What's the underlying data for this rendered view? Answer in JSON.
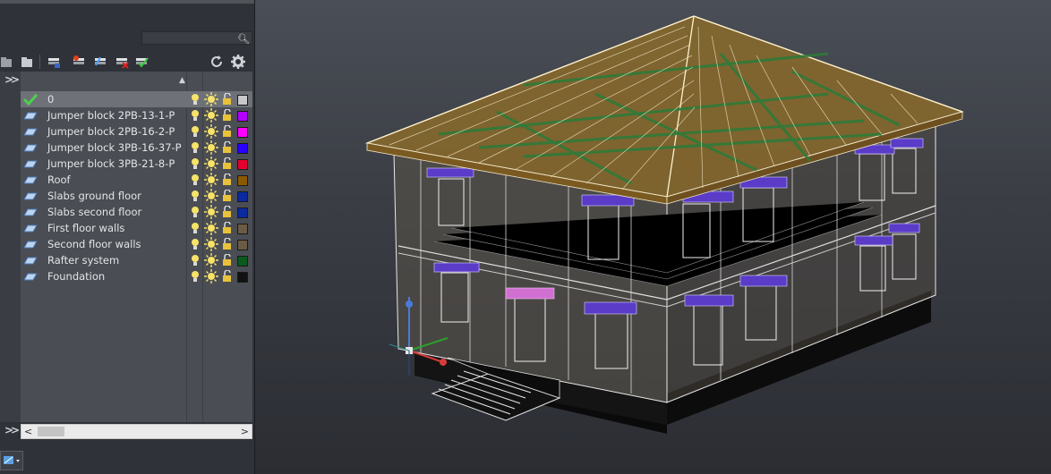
{
  "layer_panel": {
    "search_placeholder": "",
    "layers": [
      {
        "name": "0",
        "color": "#c8c8c8",
        "current": true
      },
      {
        "name": "Jumper block 2PB-13-1-P",
        "color": "#b400ff"
      },
      {
        "name": "Jumper block 2PB-16-2-P",
        "color": "#ff00ff"
      },
      {
        "name": "Jumper block 3PB-16-37-P",
        "color": "#2a00ff"
      },
      {
        "name": "Jumper block 3PB-21-8-P",
        "color": "#e6002e"
      },
      {
        "name": "Roof",
        "color": "#8a5a00"
      },
      {
        "name": "Slabs ground floor",
        "color": "#0a2aa0"
      },
      {
        "name": "Slabs second floor",
        "color": "#0a2aa0"
      },
      {
        "name": "First floor walls",
        "color": "#6b5a44"
      },
      {
        "name": "Second floor walls",
        "color": "#6b5a44"
      },
      {
        "name": "Rafter system",
        "color": "#0a5a1e"
      },
      {
        "name": "Foundation",
        "color": "#111111"
      }
    ]
  },
  "icons": {
    "search": "magnifier-icon",
    "refresh": "refresh-icon",
    "settings": "gear-icon",
    "expand": "double-chevron-icon",
    "visibility": "lightbulb-icon",
    "freeze": "sun-icon",
    "lock": "lock-icon"
  },
  "viewport": {
    "content": "3D wireframe model of a two-storey house with hip roof"
  }
}
